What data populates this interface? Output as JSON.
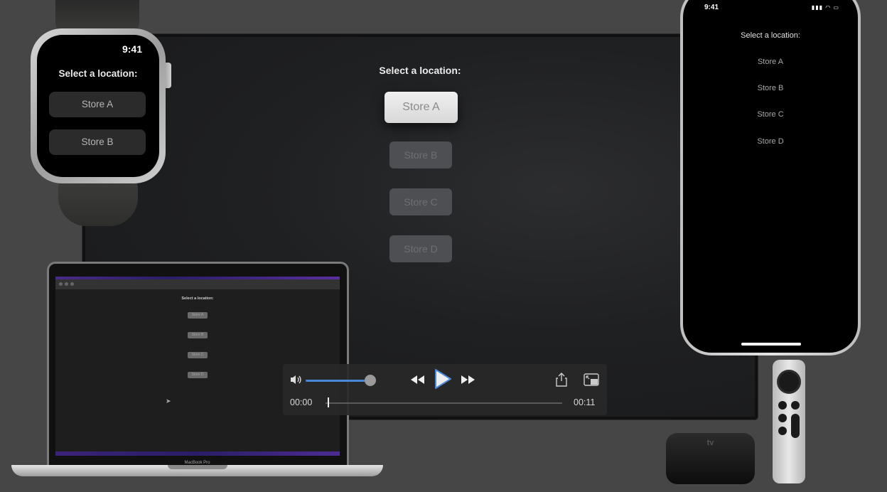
{
  "tv": {
    "title": "Select a location:",
    "buttons": [
      "Store A",
      "Store B",
      "Store C",
      "Store D"
    ]
  },
  "watch": {
    "time": "9:41",
    "title": "Select a location:",
    "buttons": [
      "Store A",
      "Store B"
    ]
  },
  "phone": {
    "time": "9:41",
    "status_icons": "signal wifi battery",
    "title": "Select a location:",
    "items": [
      "Store A",
      "Store B",
      "Store C",
      "Store D"
    ]
  },
  "mac": {
    "title": "Select a location:",
    "buttons": [
      "Store A",
      "Store B",
      "Store C",
      "Store D"
    ],
    "label": "MacBook Pro"
  },
  "atv": {
    "logo": "tv"
  },
  "player": {
    "current_time": "00:00",
    "duration": "00:11",
    "volume": 0.85,
    "progress": 0.0,
    "accent": "#4a88d8",
    "icons": [
      "speaker-icon",
      "rewind-icon",
      "play-icon",
      "fast-forward-icon",
      "share-icon",
      "picture-in-picture-icon"
    ]
  }
}
